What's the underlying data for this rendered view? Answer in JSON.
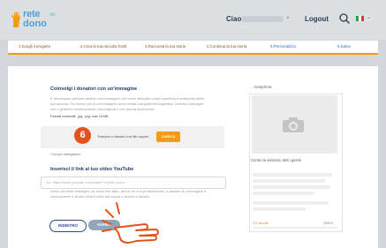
{
  "header": {
    "logo_line1": "rete",
    "logo_line2": "dono",
    "logo_small": "del",
    "greeting": "Ciao",
    "logout": "Logout",
    "flag_colors": [
      "#2e9b4a",
      "#ffffff",
      "#d53a36"
    ]
  },
  "steps": [
    {
      "label": "1.Scegli il progetto"
    },
    {
      "label": "2.Crea la tua raccolta fondi"
    },
    {
      "label": "3.Racconta la tua storia"
    },
    {
      "label": "4.Continua la tua storia"
    },
    {
      "label": "5.Personalizza"
    },
    {
      "label": "6.Salva"
    }
  ],
  "image_section": {
    "title": "Coinvolgi i donatori con un'immagine",
    "desc_line1": "È necessario caricare almeno una immagine che verrà utilizzata come copertina e anteprima della",
    "desc_line2": "tua raccolta. Se invece più di un'immagine verrà creata una galleria fotografica. Inserisci immagini,",
    "desc_line3": "foto o grafiche emotivamente coinvolgenti e con buona risoluzione.",
    "formats": "Formati consentiti: .jpg, .png, max 15 MB",
    "step_number": "6",
    "drag_text": "Trascina o rilascia i tuoi file oppure",
    "upload_button": "CARICA",
    "required": "*Campo obbligatorio"
  },
  "youtube_section": {
    "title": "Inserisci il link al tuo video YouTube",
    "placeholder": "es. https://www.youtube.com/watch?v=jWd_xxxxx",
    "desc_line1": "Ancor più delle immagini, un video ben fatto, anche se non professionale, è capace di coinvolgere e",
    "desc_line2": "commuovere e di fare centro nella tua causa o azione a donare."
  },
  "buttons": {
    "back": "INDIETRO",
    "next": "AVANTI"
  },
  "preview": {
    "label": "Anteprima",
    "card_title": "Contro la violenza, tutti i giorni!",
    "raised": "0 € raccolti",
    "goal": "2500 €"
  },
  "colors": {
    "accent": "#f39c12",
    "brand_blue": "#1f3d6b",
    "badge": "#e2531b"
  }
}
